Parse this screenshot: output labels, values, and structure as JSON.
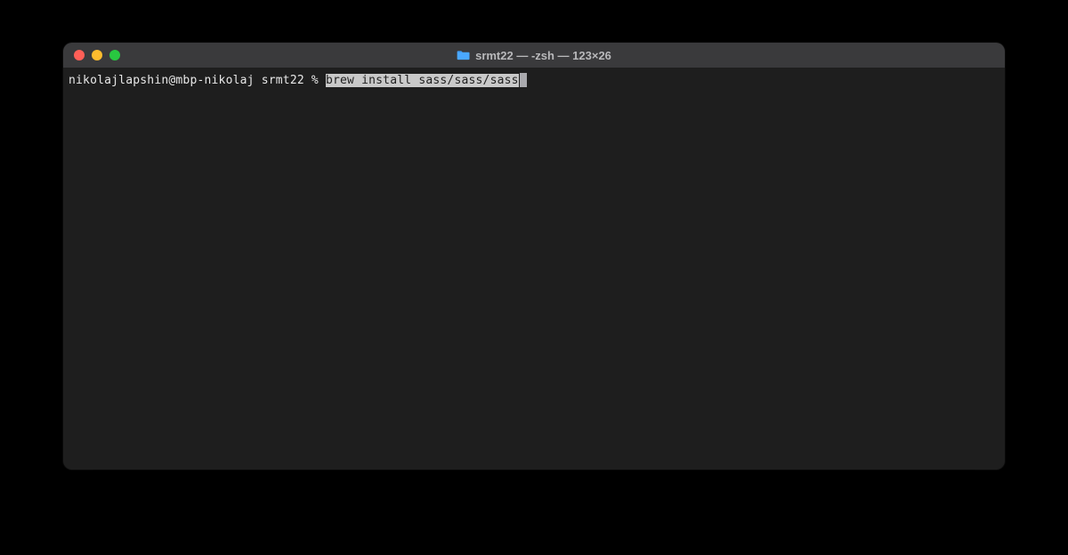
{
  "window": {
    "title": "srmt22 — -zsh — 123×26"
  },
  "terminal": {
    "prompt": "nikolajlapshin@mbp-nikolaj srmt22 % ",
    "command": "brew install sass/sass/sass"
  },
  "icons": {
    "folder": "folder-icon"
  },
  "colors": {
    "bg": "#1e1e1e",
    "titlebar": "#3a3a3c",
    "text": "#e8e8e8",
    "highlight_bg": "#c9c9c9",
    "close": "#ff5f57",
    "min": "#febc2e",
    "max": "#28c840"
  }
}
